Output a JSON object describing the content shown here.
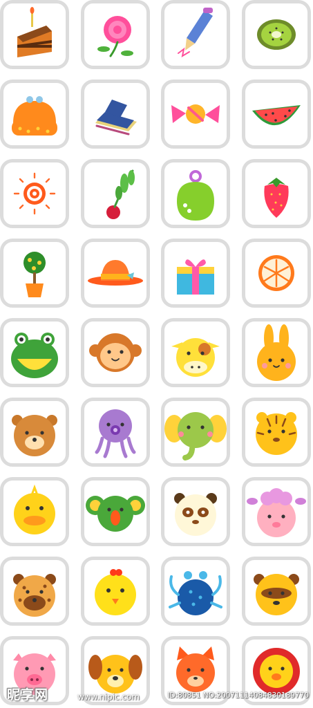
{
  "icons": [
    "cake-icon",
    "rose-icon",
    "pencil-icon",
    "kiwi-icon",
    "coin-purse-icon",
    "books-icon",
    "candy-icon",
    "watermelon-icon",
    "sun-icon",
    "radish-icon",
    "handbag-icon",
    "strawberry-icon",
    "potted-tree-icon",
    "sun-hat-icon",
    "gift-icon",
    "orange-slice-icon",
    "frog-icon",
    "monkey-icon",
    "cow-icon",
    "rabbit-icon",
    "bear-icon",
    "octopus-icon",
    "elephant-icon",
    "tiger-icon",
    "duck-icon",
    "koala-icon",
    "panda-icon",
    "sheep-icon",
    "leopard-icon",
    "chick-icon",
    "crab-icon",
    "raccoon-icon",
    "pig-icon",
    "dog-icon",
    "cat-icon",
    "lion-icon"
  ],
  "colors": {
    "tile_border": "#dcdcdc",
    "background": "#ffffff"
  },
  "watermark": {
    "logo": "昵享网",
    "url": "www.nipic.com",
    "id_text": "ID:80851 NO:20071114084830189770"
  }
}
